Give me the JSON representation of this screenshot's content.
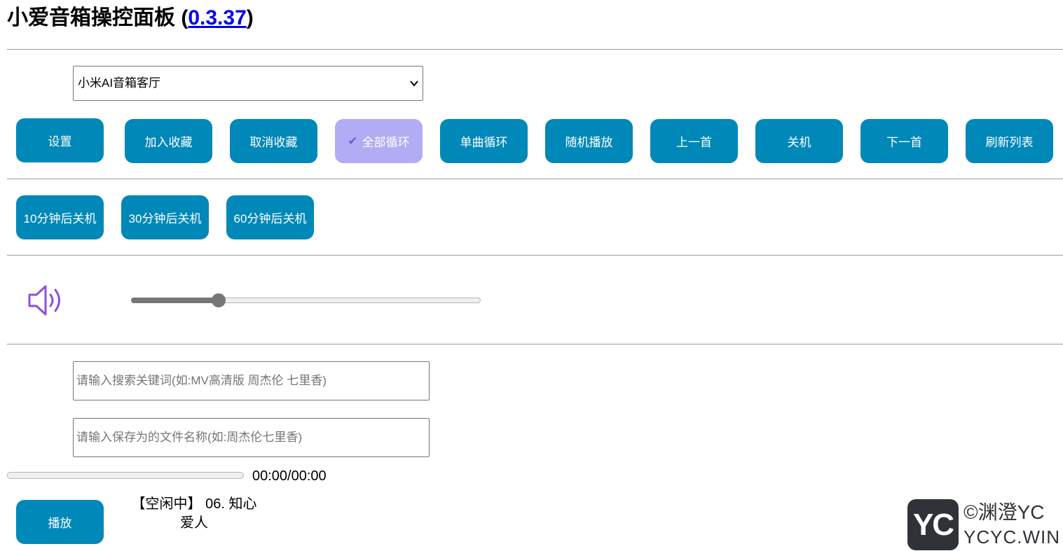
{
  "header": {
    "title": "小爱音箱操控面板",
    "version_prefix": "(",
    "version": "0.3.37",
    "version_suffix": ")"
  },
  "device_select": {
    "selected": "小米AI音箱客厅"
  },
  "controls": {
    "buttons": [
      "设置",
      "加入收藏",
      "取消收藏",
      "全部循环",
      "单曲循环",
      "随机播放",
      "上一首",
      "关机",
      "下一首",
      "刷新列表"
    ],
    "active_button": "全部循环",
    "active_color": "#b2acf4",
    "button_color": "#0088b8"
  },
  "timers": {
    "buttons": [
      "10分钟后关机",
      "30分钟后关机",
      "60分钟后关机"
    ]
  },
  "volume": {
    "icon": "speaker-icon",
    "level": 0.25
  },
  "search": {
    "keyword_placeholder": "请输入搜索关键词(如:MV高清版 周杰伦 七里香)",
    "filename_placeholder": "请输入保存为的文件名称(如:周杰伦七里香)"
  },
  "player": {
    "time": "00:00/00:00",
    "progress": 0,
    "play_label": "播放",
    "status_line1": "【空闲中】 06. 知心",
    "status_line2": "爱人"
  },
  "watermark": {
    "logo_text": "YC",
    "line1": "©渊澄YC",
    "line2": "YCYC.WIN"
  }
}
